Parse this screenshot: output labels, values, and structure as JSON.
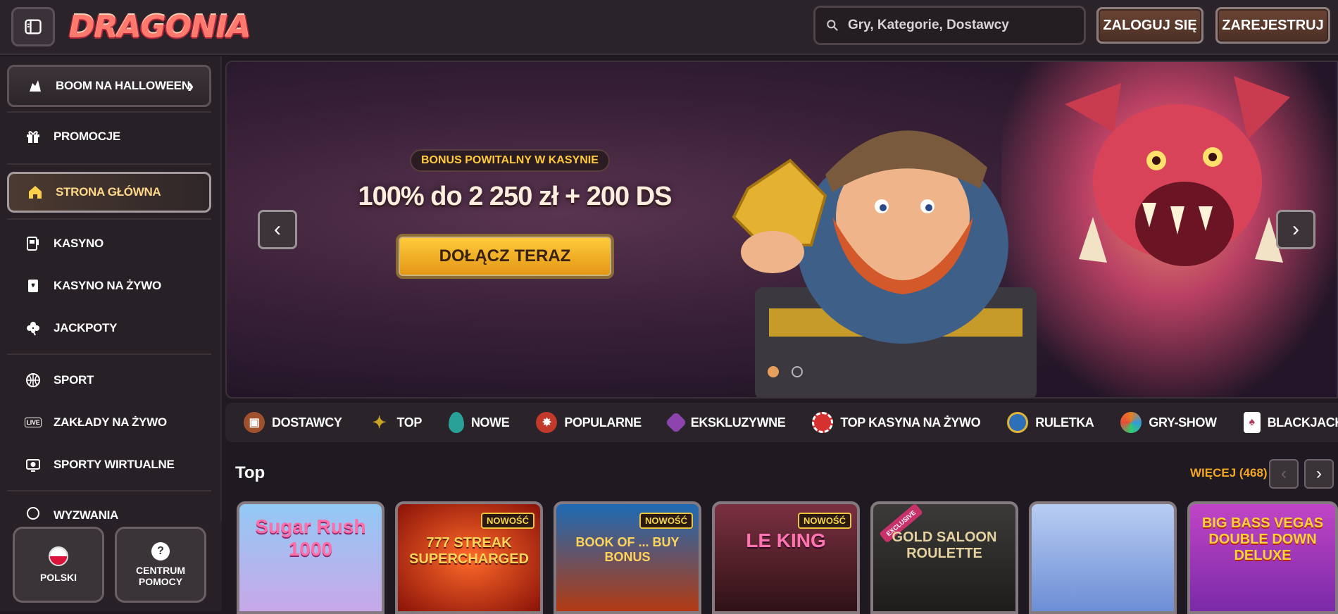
{
  "header": {
    "logo_text": "DRAGONIA",
    "search_placeholder": "Gry, Kategorie, Dostawcy",
    "login_label": "ZALOGUJ SIĘ",
    "register_label": "ZAREJESTRUJ"
  },
  "sidebar": {
    "items": [
      {
        "label": "BOOM NA HALLOWEEN",
        "icon": "halloween-icon"
      },
      {
        "label": "PROMOCJE",
        "icon": "gift-icon"
      },
      {
        "label": "STRONA GŁÓWNA",
        "icon": "home-icon"
      },
      {
        "label": "KASYNO",
        "icon": "slot-machine-icon"
      },
      {
        "label": "KASYNO NA ŻYWO",
        "icon": "cards-icon"
      },
      {
        "label": "JACKPOTY",
        "icon": "clover-icon"
      },
      {
        "label": "SPORT",
        "icon": "basketball-icon"
      },
      {
        "label": "ZAKŁADY NA ŻYWO",
        "icon": "live-icon"
      },
      {
        "label": "SPORTY WIRTUALNE",
        "icon": "virtual-sport-icon"
      },
      {
        "label": "WYZWANIA",
        "icon": "challenge-icon"
      }
    ],
    "live_badge": "LIVE",
    "language_label": "POLSKI",
    "help_label_1": "CENTRUM",
    "help_label_2": "POMOCY"
  },
  "hero": {
    "bonus_pill": "BONUS POWITALNY W KASYNIE",
    "bonus_amount": "100% do 2 250 zł + 200 DS",
    "cta_label": "DOŁĄCZ TERAZ",
    "active_slide": 1,
    "slide_count": 2
  },
  "categories": [
    {
      "label": "DOSTAWCY",
      "icon": "providers-icon",
      "color": "#a0522d"
    },
    {
      "label": "TOP",
      "icon": "star-icon",
      "color": "#c9a227"
    },
    {
      "label": "NOWE",
      "icon": "egg-icon",
      "color": "#2aa198"
    },
    {
      "label": "POPULARNE",
      "icon": "bomb-icon",
      "color": "#c0392b"
    },
    {
      "label": "EKSKLUZYWNE",
      "icon": "gem-icon",
      "color": "#8e44ad"
    },
    {
      "label": "TOP KASYNA NA ŻYWO",
      "icon": "chip-icon",
      "color": "#d63031"
    },
    {
      "label": "RULETKA",
      "icon": "roulette-icon",
      "color": "#2d6fb8"
    },
    {
      "label": "GRY-SHOW",
      "icon": "wheel-icon",
      "color": "#e67e22"
    },
    {
      "label": "BLACKJACK",
      "icon": "blackjack-icon",
      "color": "#b03a5b"
    }
  ],
  "section": {
    "title": "Top",
    "more_label": "WIĘCEJ (468)"
  },
  "games": [
    {
      "title": "Sugar Rush 1000",
      "badge": "",
      "bg": "#7fb6ee"
    },
    {
      "title": "777 STREAK SUPERCHARGED",
      "badge": "NOWOŚĆ",
      "bg": "#b21d12"
    },
    {
      "title": "BOOK OF ... BUY BONUS",
      "badge": "NOWOŚĆ",
      "bg": "#5e1f0f"
    },
    {
      "title": "LE KING",
      "badge": "NOWOŚĆ",
      "bg": "#5d2630"
    },
    {
      "title": "GOLD SALOON ROULETTE",
      "badge": "EXCLUSIVE",
      "bg": "#2a2a2a"
    },
    {
      "title": "",
      "badge": "",
      "bg": "#9fb5e8"
    },
    {
      "title": "BIG BASS VEGAS DOUBLE DOWN DELUXE",
      "badge": "",
      "bg": "#b23eb9"
    }
  ],
  "colors": {
    "background": "#1f1a22",
    "accent_gold": "#f5a623",
    "button_wood": "#5a3a2c"
  }
}
